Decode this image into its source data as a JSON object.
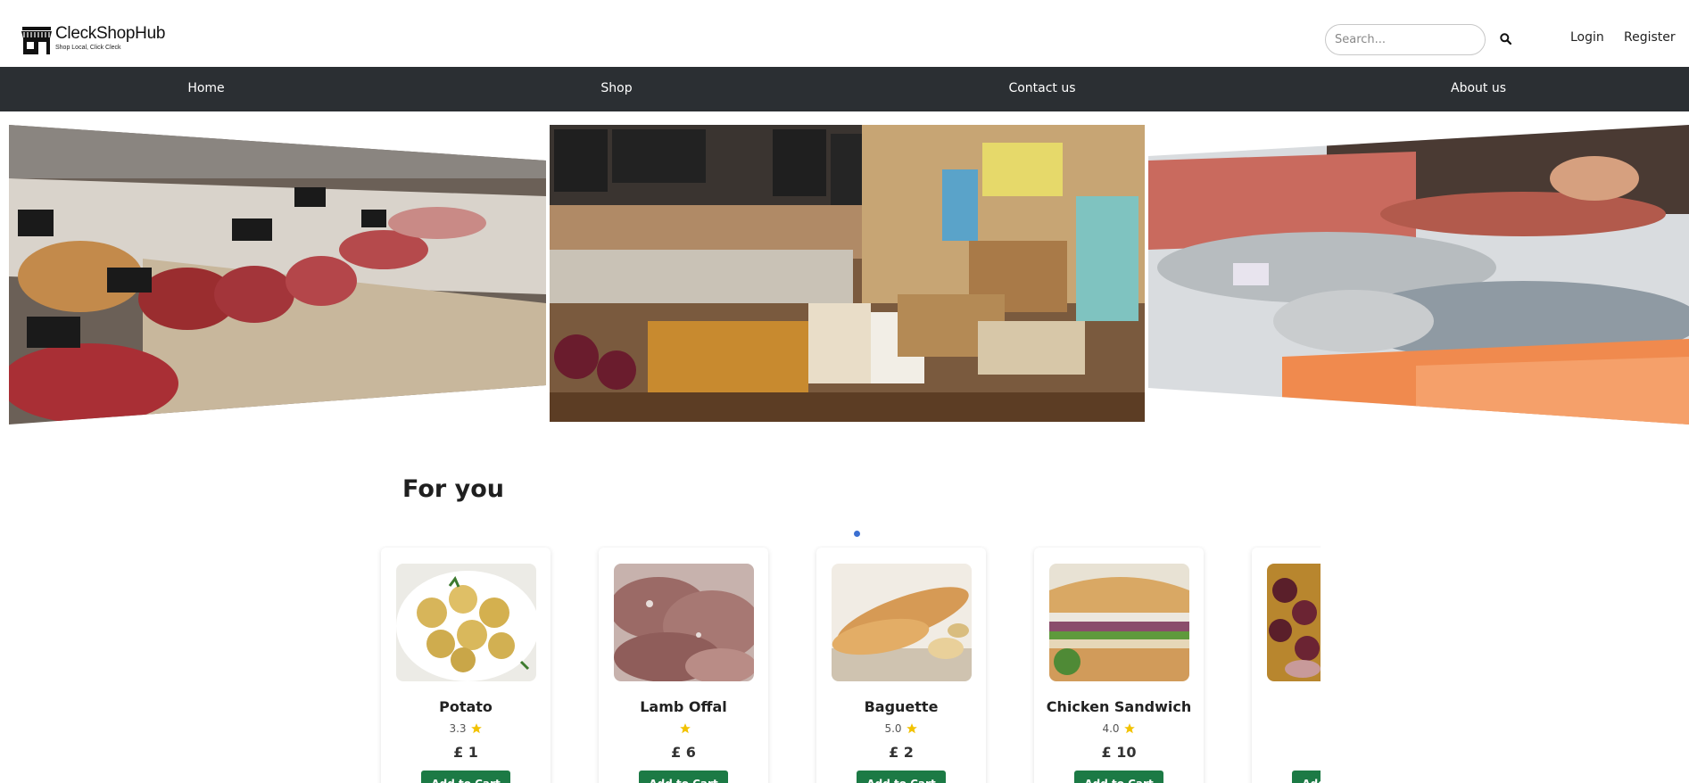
{
  "brand": {
    "name": "CleckShopHub",
    "tagline": "Shop Local, Click Cleck",
    "logo_icon": "storefront-icon"
  },
  "search": {
    "placeholder": "Search...",
    "icon": "search-icon"
  },
  "header_links": {
    "login": "Login",
    "register": "Register"
  },
  "nav": {
    "items": [
      "Home",
      "Shop",
      "Contact us",
      "About us"
    ]
  },
  "carousel": {
    "slides": [
      "butcher-counter-image",
      "deli-shop-interior-image",
      "fish-counter-image"
    ],
    "active_index": 1
  },
  "for_you": {
    "title": "For you",
    "products": [
      {
        "name": "Potato",
        "rating": "3.3",
        "price": "£ 1",
        "button": "Add to Cart"
      },
      {
        "name": "Lamb Offal",
        "rating": "",
        "price": "£ 6",
        "button": "Add to Cart"
      },
      {
        "name": "Baguette",
        "rating": "5.0",
        "price": "£ 2",
        "button": "Add to Cart"
      },
      {
        "name": "Chicken Sandwich",
        "rating": "4.0",
        "price": "£ 10",
        "button": "Add to Cart"
      },
      {
        "name": "",
        "rating": "",
        "price": "",
        "button": "Add to Cart"
      }
    ]
  },
  "colors": {
    "nav_bg": "#2b2f33",
    "button_green": "#1c7a45",
    "star": "#f2c200",
    "carousel_dot": "#3b6fd1"
  }
}
